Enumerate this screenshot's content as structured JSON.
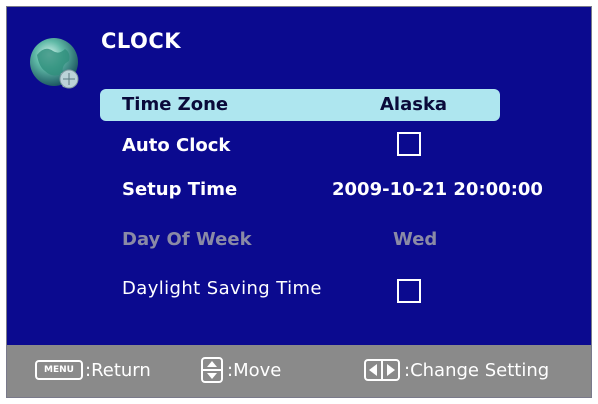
{
  "menu": {
    "title": "CLOCK",
    "icon": "globe-icon"
  },
  "rows": [
    {
      "label": "Time Zone",
      "value": "Alaska",
      "state": "selected"
    },
    {
      "label": "Auto Clock",
      "value": "",
      "control": "checkbox",
      "checked": false,
      "state": "normal"
    },
    {
      "label": "Setup Time",
      "value": "2009-10-21 20:00:00",
      "state": "normal"
    },
    {
      "label": "Day Of Week",
      "value": "Wed",
      "state": "disabled"
    },
    {
      "label": "Daylight Saving Time",
      "value": "",
      "control": "checkbox",
      "checked": false,
      "state": "normal"
    }
  ],
  "footer": {
    "menu_key": "MENU",
    "return_label": ":Return",
    "move_label": ":Move",
    "change_label": ":Change Setting"
  },
  "colors": {
    "panel_bg": "#0b0a8f",
    "selected_bg": "#aee6ef",
    "footer_bg": "#8a8a8a",
    "disabled_text": "#8a8aa6"
  }
}
